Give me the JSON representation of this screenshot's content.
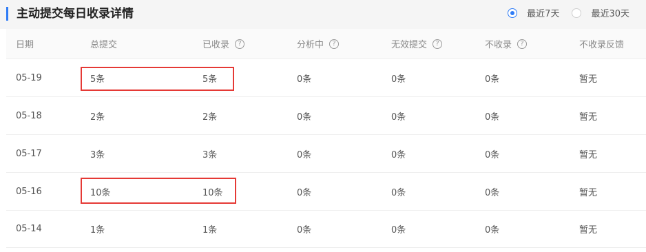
{
  "header": {
    "title": "主动提交每日收录详情",
    "range_options": [
      {
        "label": "最近7天",
        "selected": true
      },
      {
        "label": "最近30天",
        "selected": false
      }
    ]
  },
  "table": {
    "columns": [
      {
        "label": "日期",
        "help": false
      },
      {
        "label": "总提交",
        "help": false
      },
      {
        "label": "已收录",
        "help": true
      },
      {
        "label": "分析中",
        "help": true
      },
      {
        "label": "无效提交",
        "help": true
      },
      {
        "label": "不收录",
        "help": true
      },
      {
        "label": "不收录反馈",
        "help": false
      }
    ],
    "help_icon_glyph": "?",
    "rows": [
      [
        "05-19",
        "5条",
        "5条",
        "0条",
        "0条",
        "0条",
        "暂无"
      ],
      [
        "05-18",
        "2条",
        "2条",
        "0条",
        "0条",
        "0条",
        "暂无"
      ],
      [
        "05-17",
        "3条",
        "3条",
        "0条",
        "0条",
        "0条",
        "暂无"
      ],
      [
        "05-16",
        "10条",
        "10条",
        "0条",
        "0条",
        "0条",
        "暂无"
      ],
      [
        "05-14",
        "1条",
        "1条",
        "0条",
        "0条",
        "0条",
        "暂无"
      ]
    ]
  },
  "colors": {
    "accent": "#2f7cf6",
    "highlight_border": "#e53935",
    "header_bg": "#f5f5f5"
  }
}
